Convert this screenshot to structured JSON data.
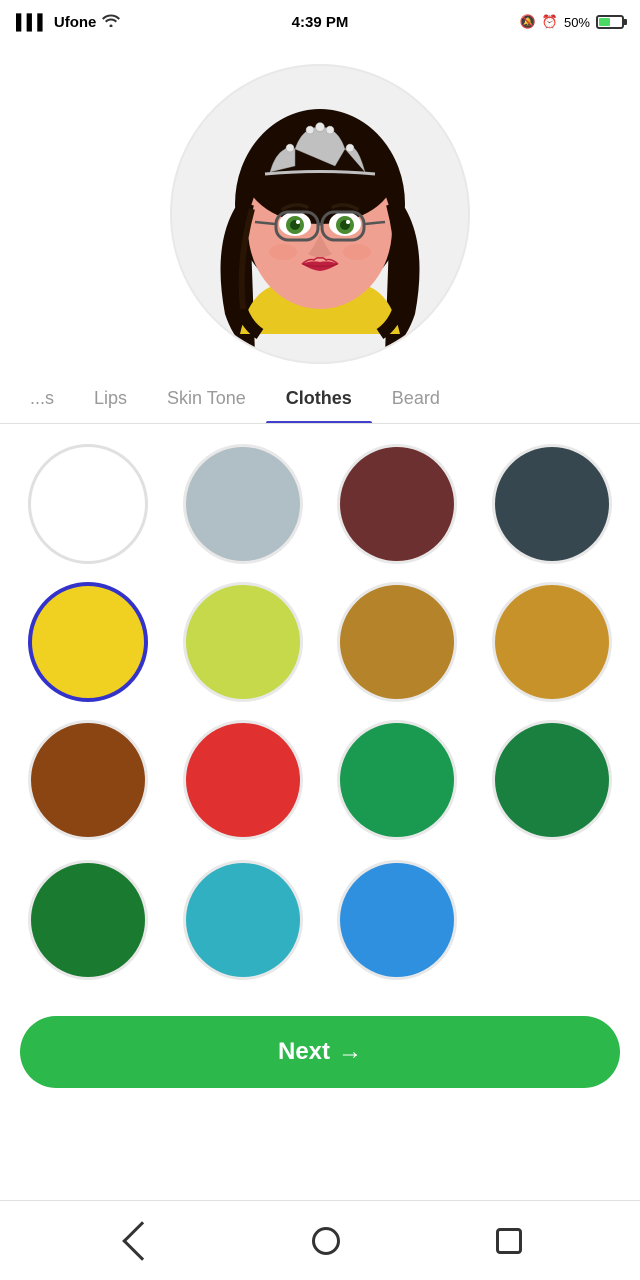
{
  "status": {
    "carrier": "Ufone",
    "time": "4:39 PM",
    "battery": "50%"
  },
  "tabs": [
    {
      "id": "brows",
      "label": "...s",
      "active": false
    },
    {
      "id": "lips",
      "label": "Lips",
      "active": false
    },
    {
      "id": "skintone",
      "label": "Skin Tone",
      "active": false
    },
    {
      "id": "clothes",
      "label": "Clothes",
      "active": true
    },
    {
      "id": "beard",
      "label": "Beard",
      "active": false
    }
  ],
  "colors": [
    {
      "id": "c1",
      "hex": "#ffffff",
      "selected": false,
      "isWhite": true
    },
    {
      "id": "c2",
      "hex": "#b0bec5",
      "selected": false
    },
    {
      "id": "c3",
      "hex": "#6d3030",
      "selected": false
    },
    {
      "id": "c4",
      "hex": "#37474f",
      "selected": false
    },
    {
      "id": "c5",
      "hex": "#f0d020",
      "selected": true
    },
    {
      "id": "c6",
      "hex": "#c6d94a",
      "selected": false
    },
    {
      "id": "c7",
      "hex": "#b5832a",
      "selected": false
    },
    {
      "id": "c8",
      "hex": "#c8922a",
      "selected": false
    },
    {
      "id": "c9",
      "hex": "#8B4513",
      "selected": false
    },
    {
      "id": "c10",
      "hex": "#e03030",
      "selected": false
    },
    {
      "id": "c11",
      "hex": "#1a9950",
      "selected": false
    },
    {
      "id": "c12",
      "hex": "#1a8040",
      "selected": false
    }
  ],
  "partial_colors": [
    {
      "id": "p1",
      "hex": "#1a7a30"
    },
    {
      "id": "p2",
      "hex": "#30b0c0"
    },
    {
      "id": "p3",
      "hex": "#3090e0"
    },
    {
      "id": "p4",
      "hex": "#transparent"
    }
  ],
  "next_button": {
    "label": "Next",
    "arrow": "→"
  }
}
